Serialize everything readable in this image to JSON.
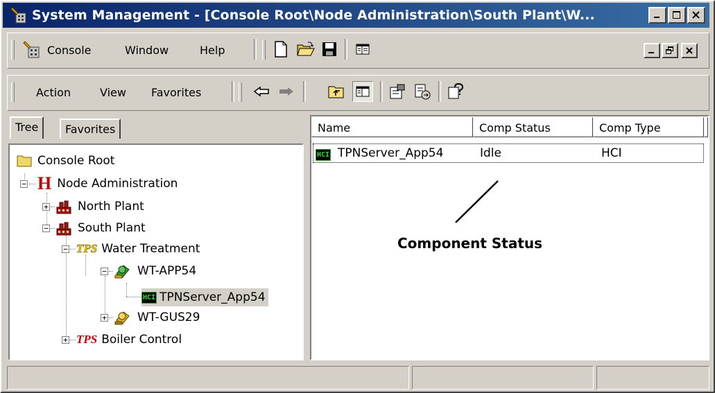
{
  "window": {
    "title": "System Management - [Console Root\\Node Administration\\South Plant\\W..."
  },
  "menubar": {
    "console": "Console",
    "window": "Window",
    "help": "Help"
  },
  "actionbar": {
    "action": "Action",
    "view": "View",
    "favorites": "Favorites"
  },
  "tabs": {
    "tree": "Tree",
    "favorites": "Favorites"
  },
  "tree": {
    "console_root": "Console Root",
    "node_admin": "Node Administration",
    "north_plant": "North Plant",
    "south_plant": "South Plant",
    "water_treatment": "Water Treatment",
    "wt_app54": "WT-APP54",
    "tpnserver": "TPNServer_App54",
    "wt_gus29": "WT-GUS29",
    "boiler_control": "Boiler Control",
    "badge_tps": "TPS",
    "badge_h": "H",
    "badge_hci": "HCI"
  },
  "list": {
    "columns": [
      "Name",
      "Comp Status",
      "Comp Type"
    ],
    "rows": [
      {
        "name": "TPNServer_App54",
        "status": "Idle",
        "type": "HCI"
      }
    ]
  },
  "annotation": {
    "label": "Component Status"
  },
  "colors": {
    "title_start": "#0a246a",
    "title_end": "#3a6ea5",
    "chrome": "#d4d0c8",
    "tps_red": "#c00000",
    "tps_yellow": "#e8d000"
  }
}
